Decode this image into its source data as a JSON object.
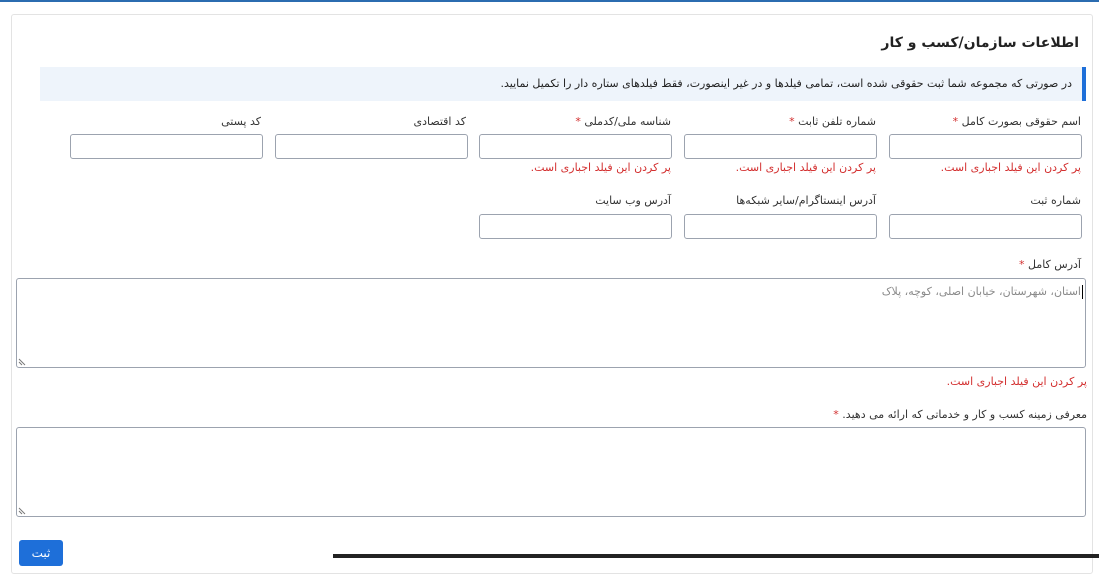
{
  "form": {
    "title": "اطلاعات سازمان/کسب و کار",
    "notice": "در صورتی که مجموعه شما ثبت حقوقی شده است، تمامی فیلدها و در غیر اینصورت، فقط فیلدهای ستاره دار را تکمیل نمایید.",
    "required_mark": "*",
    "error_message": "پر کردن این فیلد اجباری است.",
    "fields": {
      "legal_name": {
        "label": "اسم حقوقی بصورت کامل",
        "value": ""
      },
      "landline": {
        "label": "شماره تلفن ثابت",
        "value": ""
      },
      "national_id": {
        "label": "شناسه ملی/کدملی",
        "value": ""
      },
      "economic_code": {
        "label": "کد اقتصادی",
        "value": ""
      },
      "postal_code": {
        "label": "کد پستی",
        "value": ""
      },
      "registration_no": {
        "label": "شماره ثبت",
        "value": ""
      },
      "instagram": {
        "label": "آدرس اینستاگرام/سایر شبکه‌ها",
        "value": ""
      },
      "website": {
        "label": "آدرس وب سایت",
        "value": ""
      },
      "full_address": {
        "label": "آدرس کامل",
        "placeholder": "استان، شهرستان، خیابان اصلی، کوچه، پلاک",
        "value": ""
      },
      "business_intro": {
        "label": "معرفی زمینه کسب و کار و خدماتی که ارائه می دهید.",
        "value": ""
      }
    },
    "submit_label": "ثبت"
  }
}
